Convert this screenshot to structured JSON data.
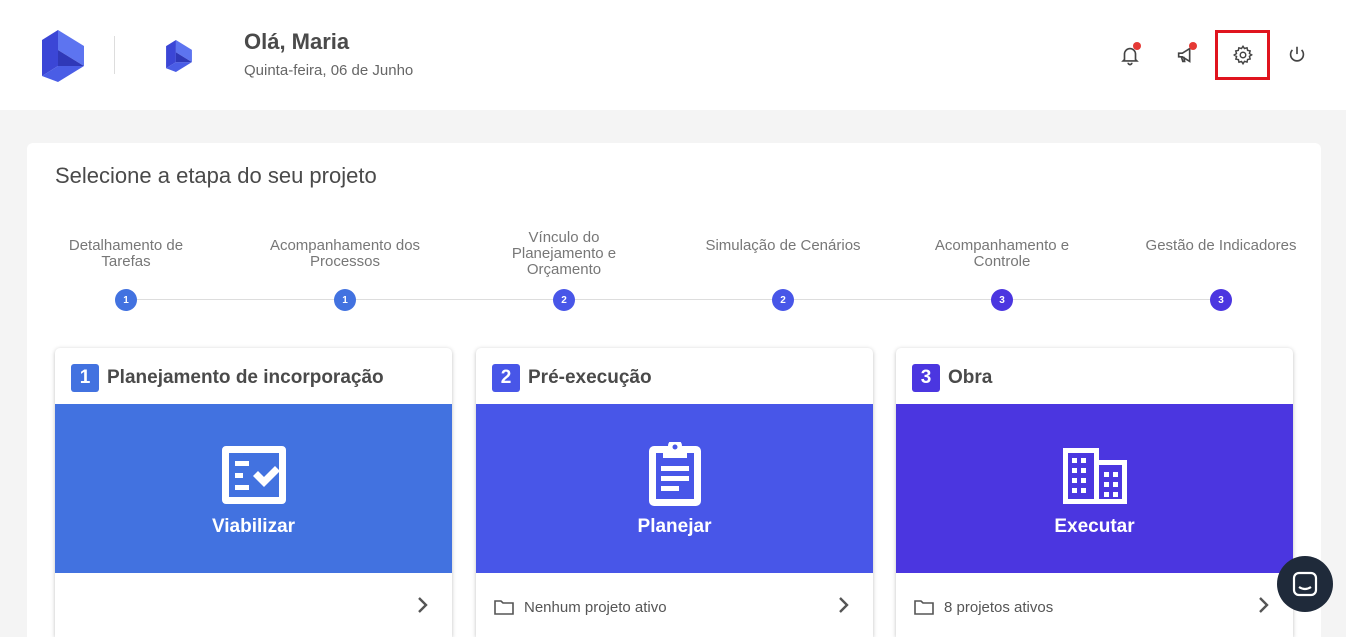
{
  "header": {
    "greeting": "Olá, Maria",
    "date": "Quinta-feira, 06 de Junho",
    "icons": [
      "bell-icon",
      "megaphone-icon",
      "gear-icon",
      "power-icon"
    ],
    "notification_color": "#e53935",
    "highlight_color": "#e0141e"
  },
  "main": {
    "title": "Selecione a etapa do seu projeto",
    "steps": [
      {
        "label": "Detalhamento de Tarefas",
        "num": "1"
      },
      {
        "label": "Acompanhamento dos Processos",
        "num": "1"
      },
      {
        "label": "Vínculo do Planejamento e Orçamento",
        "num": "2"
      },
      {
        "label": "Simulação de Cenários",
        "num": "2"
      },
      {
        "label": "Acompanhamento e Controle",
        "num": "3"
      },
      {
        "label": "Gestão de Indicadores",
        "num": "3"
      }
    ],
    "cards": [
      {
        "num": "1",
        "title": "Planejamento de incorporação",
        "action": "Viabilizar",
        "footer": "",
        "color": "#4272e0",
        "icon": "checklist-icon"
      },
      {
        "num": "2",
        "title": "Pré-execução",
        "action": "Planejar",
        "footer": "Nenhum projeto ativo",
        "color": "#4856e8",
        "icon": "clipboard-icon"
      },
      {
        "num": "3",
        "title": "Obra",
        "action": "Executar",
        "footer": "8 projetos ativos",
        "color": "#4b36e0",
        "icon": "building-icon"
      }
    ]
  }
}
